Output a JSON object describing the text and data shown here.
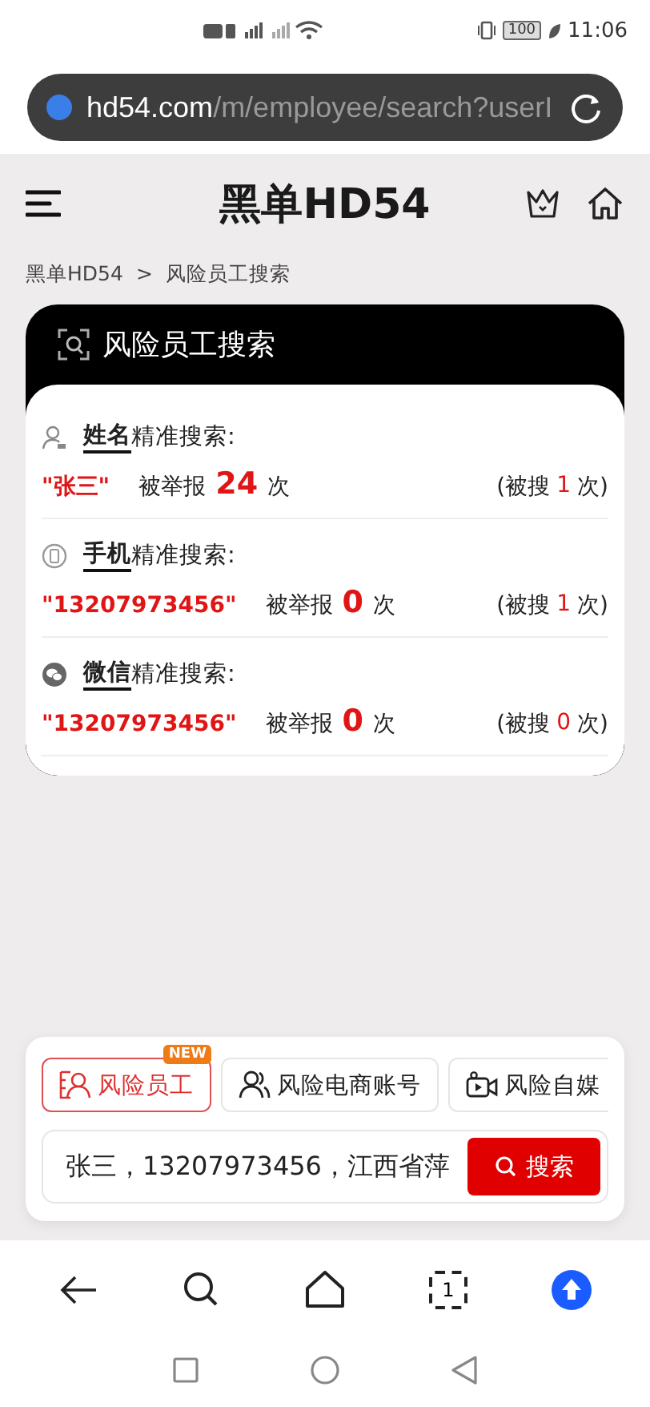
{
  "status_bar": {
    "battery": "100",
    "time": "11:06"
  },
  "address_bar": {
    "domain": "hd54.com",
    "path": "/m/employee/search?userI"
  },
  "header": {
    "logo": "黑单HD54"
  },
  "breadcrumb": [
    {
      "label": "黑单HD54"
    },
    {
      "label": "风险员工搜索"
    }
  ],
  "breadcrumb_separator": ">",
  "result_card": {
    "title": "风险员工搜索",
    "results": [
      {
        "kind": "name",
        "field": "姓名",
        "label": "精准搜索:",
        "query": "\"张三\"",
        "reported_label": "被举报",
        "reported_count": "24",
        "unit": "次",
        "searched_open": "(被搜",
        "searched_count": "1",
        "searched_close": "次)"
      },
      {
        "kind": "phone",
        "field": "手机",
        "label": "精准搜索:",
        "query": "\"13207973456\"",
        "reported_label": "被举报",
        "reported_count": "0",
        "unit": "次",
        "searched_open": "(被搜",
        "searched_count": "1",
        "searched_close": "次)"
      },
      {
        "kind": "wechat",
        "field": "微信",
        "label": "精准搜索:",
        "query": "\"13207973456\"",
        "reported_label": "被举报",
        "reported_count": "0",
        "unit": "次",
        "searched_open": "(被搜",
        "searched_count": "0",
        "searched_close": "次)"
      }
    ]
  },
  "search_panel": {
    "tabs": [
      {
        "kind": "employee",
        "label": "风险员工",
        "selected": true,
        "badge": "NEW"
      },
      {
        "kind": "shop",
        "label": "风险电商账号",
        "selected": false
      },
      {
        "kind": "media",
        "label": "风险自媒",
        "selected": false
      }
    ],
    "input_value": "张三，13207973456，江西省萍",
    "button": "搜索"
  },
  "browser_nav": {
    "tab_count": "1"
  }
}
